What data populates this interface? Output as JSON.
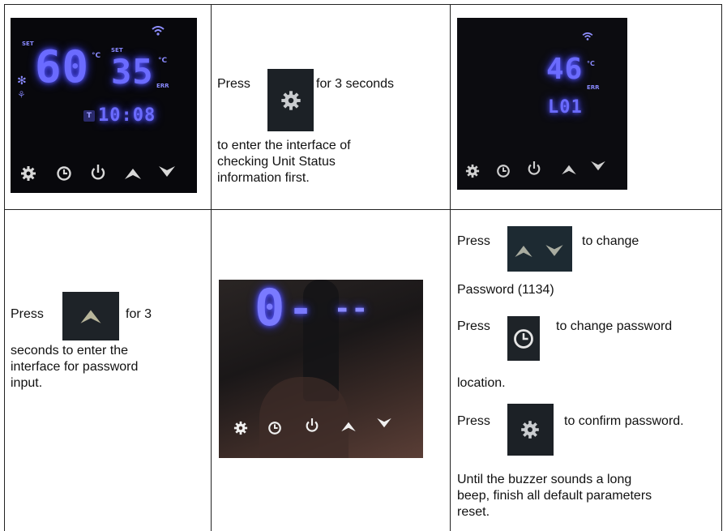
{
  "row1": {
    "panel1": {
      "set_left": "SET",
      "temp_left": "60",
      "unit_left": "°C",
      "set_right": "SET",
      "temp_right": "35",
      "unit_right": "°C",
      "err": "ERR",
      "clock": "10:08",
      "t_badge": "T"
    },
    "middle": {
      "press": "Press",
      "after_icon": "for 3 seconds",
      "line1": "to enter the interface of",
      "line2": "checking Unit Status",
      "line3": "information first."
    },
    "panel3": {
      "temp": "46",
      "unit": "°C",
      "err": "ERR",
      "code": "L01"
    }
  },
  "row2": {
    "left": {
      "press": "Press",
      "after_icon": "for 3",
      "line1": "seconds to enter the",
      "line2": "interface for  password",
      "line3": "input."
    },
    "photo": {
      "digit_big": "0",
      "dash": "-",
      "right": "--"
    },
    "right": {
      "p1_press": "Press",
      "p1_after": "to change",
      "p1_line": "Password (1134)",
      "p2_press": "Press",
      "p2_after": "to change password",
      "p2_line": "location.",
      "p3_press": "Press",
      "p3_after": "to confirm password.",
      "p4_line1": "Until the buzzer sounds a long",
      "p4_line2": "beep, finish all default parameters",
      "p4_line3": "reset."
    }
  },
  "icons": [
    "gear-icon",
    "clock-icon",
    "power-icon",
    "up-arrow-icon",
    "down-arrow-icon",
    "wifi-icon",
    "snowflake-icon"
  ]
}
